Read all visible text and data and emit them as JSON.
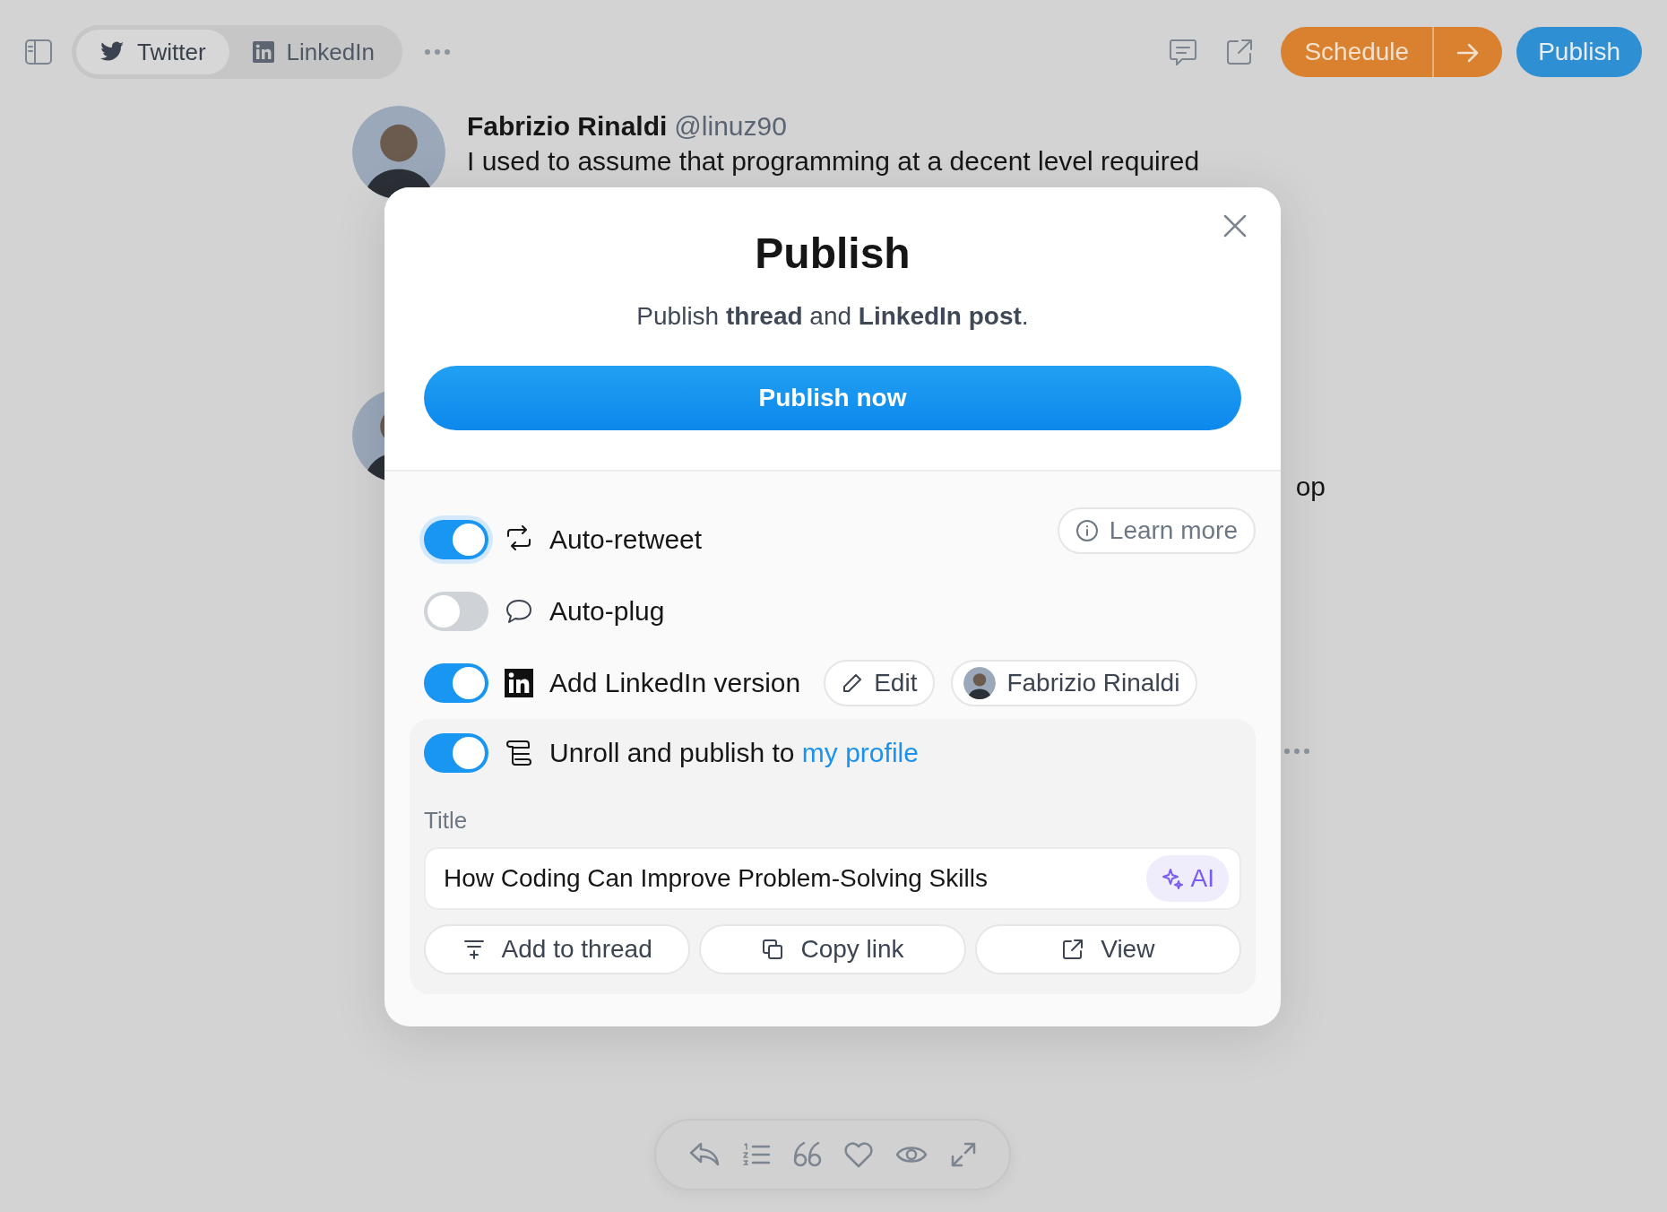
{
  "toolbar": {
    "tabs": [
      {
        "label": "Twitter",
        "selected": true
      },
      {
        "label": "LinkedIn",
        "selected": false
      }
    ],
    "schedule_button": "Schedule",
    "publish_button": "Publish"
  },
  "posts": [
    {
      "author": "Fabrizio Rinaldi",
      "handle": "@linuz90",
      "text": "I used to assume that programming at a decent level required"
    },
    {
      "text": "op"
    }
  ],
  "modal": {
    "title": "Publish",
    "subtitle": "Publish **thread** and **LinkedIn post**.",
    "primary_button": "Publish now",
    "learn_more": "Learn more",
    "options": [
      {
        "kind": "retweet",
        "label": "Auto-retweet",
        "on": true,
        "focused": true
      },
      {
        "kind": "plug",
        "label": "Auto-plug",
        "on": false,
        "focused": false
      },
      {
        "kind": "linkedin",
        "label": "Add LinkedIn version",
        "on": true,
        "focused": false,
        "edit_button": "Edit",
        "account": "Fabrizio Rinaldi"
      },
      {
        "kind": "unroll",
        "label": "Unroll and publish to",
        "link": "my profile",
        "on": true,
        "focused": false
      }
    ],
    "title_field": {
      "label": "Title",
      "value": "How Coding Can Improve Problem-Solving Skills",
      "ai_button": "AI"
    },
    "actions": [
      {
        "kind": "add",
        "label": "Add to thread"
      },
      {
        "kind": "copy",
        "label": "Copy link"
      },
      {
        "kind": "view",
        "label": "View"
      }
    ]
  }
}
